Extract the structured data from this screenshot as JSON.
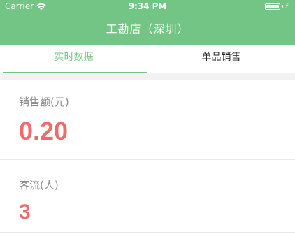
{
  "status_bar": {
    "carrier": "Carrier",
    "time": "9:34 PM",
    "battery_percent": 100
  },
  "nav": {
    "title": "工勘店（深圳）"
  },
  "tabs": [
    {
      "label": "实时数据",
      "active": true
    },
    {
      "label": "单品销售",
      "active": false
    }
  ],
  "metrics": [
    {
      "label": "销售额(元)",
      "value": "0.20"
    },
    {
      "label": "客流(人)",
      "value": "3"
    }
  ],
  "colors": {
    "header_green": "#72c584",
    "value_red": "#ef6b6b",
    "label_gray": "#8a8a8a"
  },
  "icons": {
    "wifi": "wifi-icon",
    "battery": "battery-icon",
    "charging": "bolt-icon"
  }
}
